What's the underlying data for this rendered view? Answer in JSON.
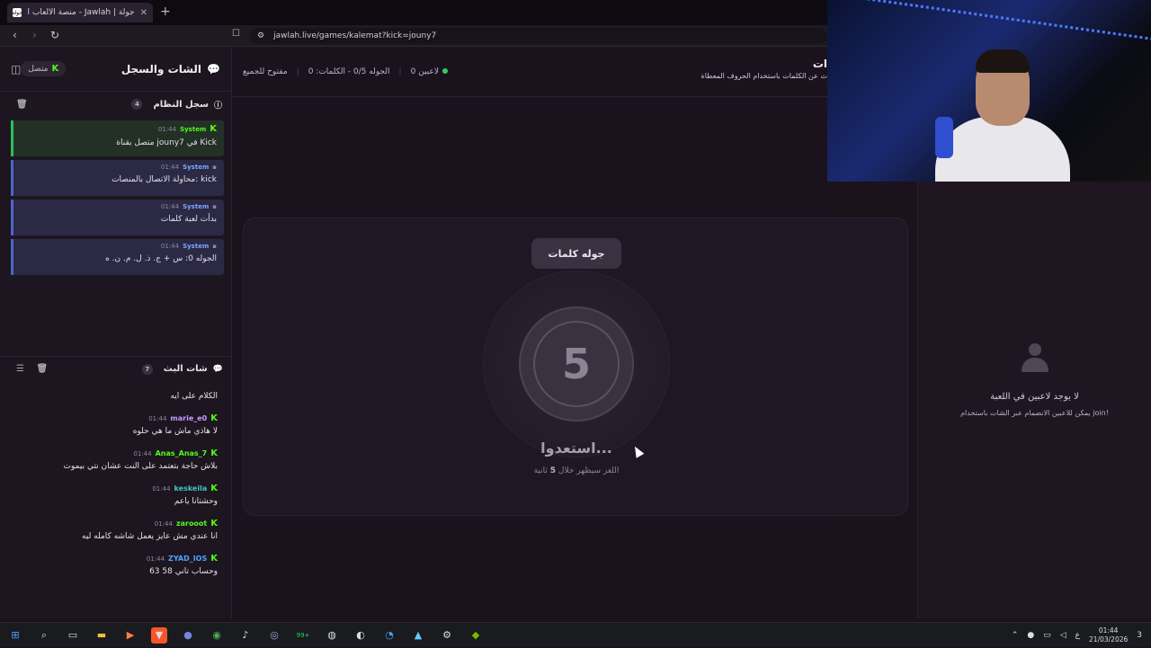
{
  "browser": {
    "tab_title": "جولة | Jawlah - منصة الألعاب التفا",
    "favicon_text": "جولة",
    "tab_close": "✕",
    "new_tab": "+",
    "url": "jawlah.live/games/kalemat?kick=jouny7",
    "back": "‹",
    "forward": "›",
    "reload": "↻",
    "bookmark": "☐"
  },
  "sidebar": {
    "title": "الشات والسجل",
    "status": "متصل",
    "kick_glyph": "K",
    "system_log": {
      "title": "سجل النظام",
      "count": "4",
      "messages": [
        {
          "sender": "System",
          "time": "01:44",
          "text": "متصل بقناة jouny7 في Kick"
        },
        {
          "sender": "System",
          "time": "01:44",
          "text": "محاولة الاتصال بالمنصات: kick"
        },
        {
          "sender": "System",
          "time": "01:44",
          "text": "بدأت لعبة كلمات"
        },
        {
          "sender": "System",
          "time": "01:44",
          "text": "الجوله 0: س + ج. ذ. ل. م. ن. ه"
        }
      ]
    },
    "stream_chat": {
      "title": "شات البث",
      "count": "7",
      "first_line": "الكلام على ايه",
      "messages": [
        {
          "user": "marie_e0",
          "time": "01:44",
          "text": "لا هاذي ماش ما هي حلوه",
          "color": "#c79bff"
        },
        {
          "user": "Anas_Anas_7",
          "time": "01:44",
          "text": "بلاش حاجة بتعتمد على النت عشان نتي بيموت",
          "color": "#53fc18"
        },
        {
          "user": "keskeila",
          "time": "01:44",
          "text": "وحشتانا ياعم",
          "color": "#3fc6c6"
        },
        {
          "user": "zarooot",
          "time": "01:44",
          "text": "انا عندي مش عايز يعمل شاشه كامله ليه",
          "color": "#53fc18"
        },
        {
          "user": "ZYAD_IOS",
          "time": "01:44",
          "text": "63 وحساب تاني 58",
          "color": "#4ea3ff"
        }
      ]
    }
  },
  "main": {
    "online": "0 لاعبين",
    "round_info": "الجوله 0/5 - الكلمات: 0",
    "open_to_all": "مفتوح للجميع",
    "game_title": "ات",
    "game_subtitle": "ث عن الكلمات باستخدام الحروف المعطاة",
    "round_badge": "جوله كلمات",
    "countdown": "5",
    "ready_text": "استعدوا...",
    "hint_before": "اللغز سيظهر خلال",
    "hint_seconds": "5",
    "hint_after": "ثانية"
  },
  "players": {
    "empty_title": "لا يوجد لاعبين في اللعبة",
    "empty_hint": "يمكن للاعبين الانضمام عبر الشات باستخدام join!"
  },
  "taskbar": {
    "icons": [
      "windows-icon",
      "search-icon",
      "task-view-icon",
      "file-explorer-icon",
      "media-player-icon",
      "brave-icon",
      "discord-icon",
      "chrome-icon",
      "tiktok-icon",
      "steam-icon",
      "whatsapp-icon",
      "obs-icon",
      "app-icon",
      "edge-icon",
      "app2-icon",
      "settings-icon",
      "nvidia-icon"
    ],
    "badge": "99+",
    "lang": "ع",
    "time": "01:44",
    "date": "21/03/2026",
    "notif": "3"
  },
  "colors": {
    "kick_green": "#53fc18",
    "online_dot": "#2dd15a",
    "system_blue": "#4a66c8"
  }
}
